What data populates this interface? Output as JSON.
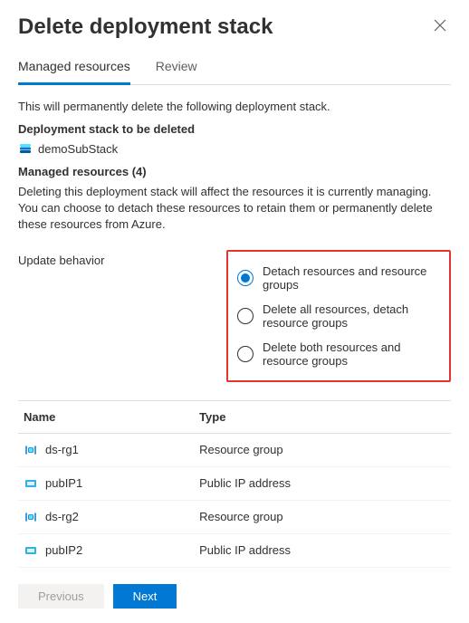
{
  "header": {
    "title": "Delete deployment stack"
  },
  "tabs": [
    {
      "label": "Managed resources",
      "active": true
    },
    {
      "label": "Review",
      "active": false
    }
  ],
  "intro_text": "This will permanently delete the following deployment stack.",
  "section_stack_label": "Deployment stack to be deleted",
  "stack_name": "demoSubStack",
  "managed_resources_label": "Managed resources (4)",
  "description_text": "Deleting this deployment stack will affect the resources it is currently managing. You can choose to detach these resources to retain them or permanently delete these resources from Azure.",
  "behavior_label": "Update behavior",
  "radio_options": [
    {
      "label": "Detach resources and resource groups",
      "selected": true
    },
    {
      "label": "Delete all resources, detach resource groups",
      "selected": false
    },
    {
      "label": "Delete both resources and resource groups",
      "selected": false
    }
  ],
  "table": {
    "columns": [
      "Name",
      "Type"
    ],
    "rows": [
      {
        "name": "ds-rg1",
        "type": "Resource group",
        "icon": "rg"
      },
      {
        "name": "pubIP1",
        "type": "Public IP address",
        "icon": "ip"
      },
      {
        "name": "ds-rg2",
        "type": "Resource group",
        "icon": "rg"
      },
      {
        "name": "pubIP2",
        "type": "Public IP address",
        "icon": "ip"
      }
    ]
  },
  "footer": {
    "previous": "Previous",
    "next": "Next"
  }
}
